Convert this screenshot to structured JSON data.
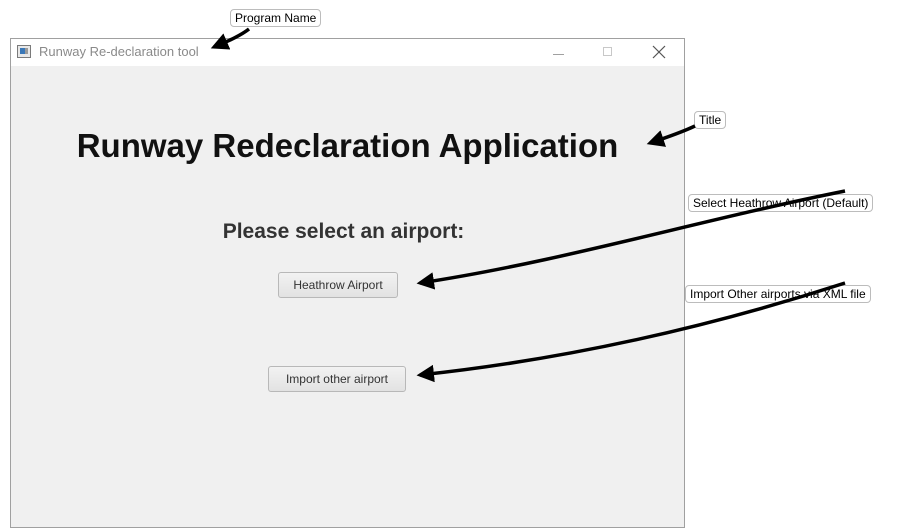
{
  "window": {
    "title": "Runway Re-declaration tool",
    "controls": {
      "minimize": "minimize",
      "maximize": "maximize",
      "close": "close"
    }
  },
  "content": {
    "app_title": "Runway Redeclaration Application",
    "select_label": "Please select an airport:",
    "heathrow_button": "Heathrow Airport",
    "import_button": "Import other airport"
  },
  "annotations": {
    "program_name": "Program Name",
    "title": "Title",
    "heathrow": "Select Heathrow Airport (Default)",
    "import": "Import Other airports via XML file"
  },
  "colors": {
    "window_bg": "#f0f0f0",
    "titlebar_bg": "#ffffff",
    "arrow": "#000000"
  },
  "icons": [
    "app-window-icon",
    "minimize-icon",
    "maximize-icon",
    "close-icon",
    "arrow-icon"
  ]
}
